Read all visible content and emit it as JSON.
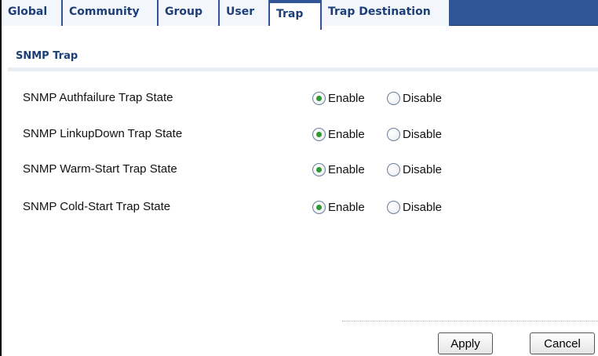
{
  "tabs": [
    {
      "label": "Global"
    },
    {
      "label": "Community"
    },
    {
      "label": "Group"
    },
    {
      "label": "User"
    },
    {
      "label": "Trap",
      "active": true
    },
    {
      "label": "Trap Destination"
    }
  ],
  "section": {
    "title": "SNMP Trap"
  },
  "rows": [
    {
      "label": "SNMP Authfailure Trap State",
      "enable": "Enable",
      "disable": "Disable",
      "selected": "Enable"
    },
    {
      "label": "SNMP LinkupDown Trap State",
      "enable": "Enable",
      "disable": "Disable",
      "selected": "Enable"
    },
    {
      "label": "SNMP Warm-Start Trap State",
      "enable": "Enable",
      "disable": "Disable",
      "selected": "Enable"
    },
    {
      "label": "SNMP Cold-Start Trap State",
      "enable": "Enable",
      "disable": "Disable",
      "selected": "Enable"
    }
  ],
  "buttons": {
    "apply": "Apply",
    "cancel": "Cancel"
  },
  "colors": {
    "tabbar": "#2f5597",
    "tab_text": "#1c3f7a",
    "radio_checked": "#2f9a2f"
  }
}
